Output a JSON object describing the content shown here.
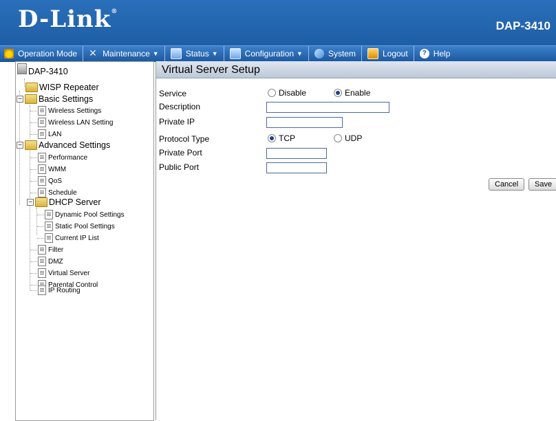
{
  "header": {
    "brand": "D-Link",
    "brand_mark": "®",
    "model": "DAP-3410"
  },
  "nav": [
    {
      "label": "Operation Mode",
      "icon": "home-icon",
      "color": "#f2c200",
      "dropdown": false
    },
    {
      "label": "Maintenance",
      "icon": "tools-icon",
      "color": "#d9d9d9",
      "dropdown": true
    },
    {
      "label": "Status",
      "icon": "monitor-icon",
      "color": "#8fc0ff",
      "dropdown": true
    },
    {
      "label": "Configuration",
      "icon": "monitor-icon",
      "color": "#8fc0ff",
      "dropdown": true
    },
    {
      "label": "System",
      "icon": "network-icon",
      "color": "#8fc0ff",
      "dropdown": false
    },
    {
      "label": "Logout",
      "icon": "logout-icon",
      "color": "#f2a300",
      "dropdown": false
    },
    {
      "label": "Help",
      "icon": "help-icon",
      "color": "#cfe0ff",
      "dropdown": false
    }
  ],
  "sidebar": {
    "root": "DAP-3410",
    "items": {
      "wisp": "WISP Repeater",
      "basic": "Basic Settings",
      "wireless": "Wireless Settings",
      "wlan": "Wireless LAN Setting",
      "lan": "LAN",
      "advanced": "Advanced Settings",
      "performance": "Performance",
      "wmm": "WMM",
      "qos": "QoS",
      "schedule": "Schedule",
      "dhcp": "DHCP Server",
      "dynamic": "Dynamic Pool Settings",
      "static": "Static Pool Settings",
      "currentip": "Current IP List",
      "filter": "Filter",
      "dmz": "DMZ",
      "virtual": "Virtual Server",
      "parental": "Parental Control",
      "routing": "IP Routing"
    }
  },
  "page": {
    "title": "Virtual Server Setup",
    "service_label": "Service",
    "service_disable": "Disable",
    "service_enable": "Enable",
    "description_label": "Description",
    "description_value": "",
    "private_ip_label": "Private IP",
    "private_ip_value": "",
    "protocol_label": "Protocol Type",
    "protocol_tcp": "TCP",
    "protocol_udp": "UDP",
    "private_port_label": "Private Port",
    "private_port_value": "",
    "public_port_label": "Public Port",
    "public_port_value": "",
    "cancel_label": "Cancel",
    "save_label": "Save"
  }
}
